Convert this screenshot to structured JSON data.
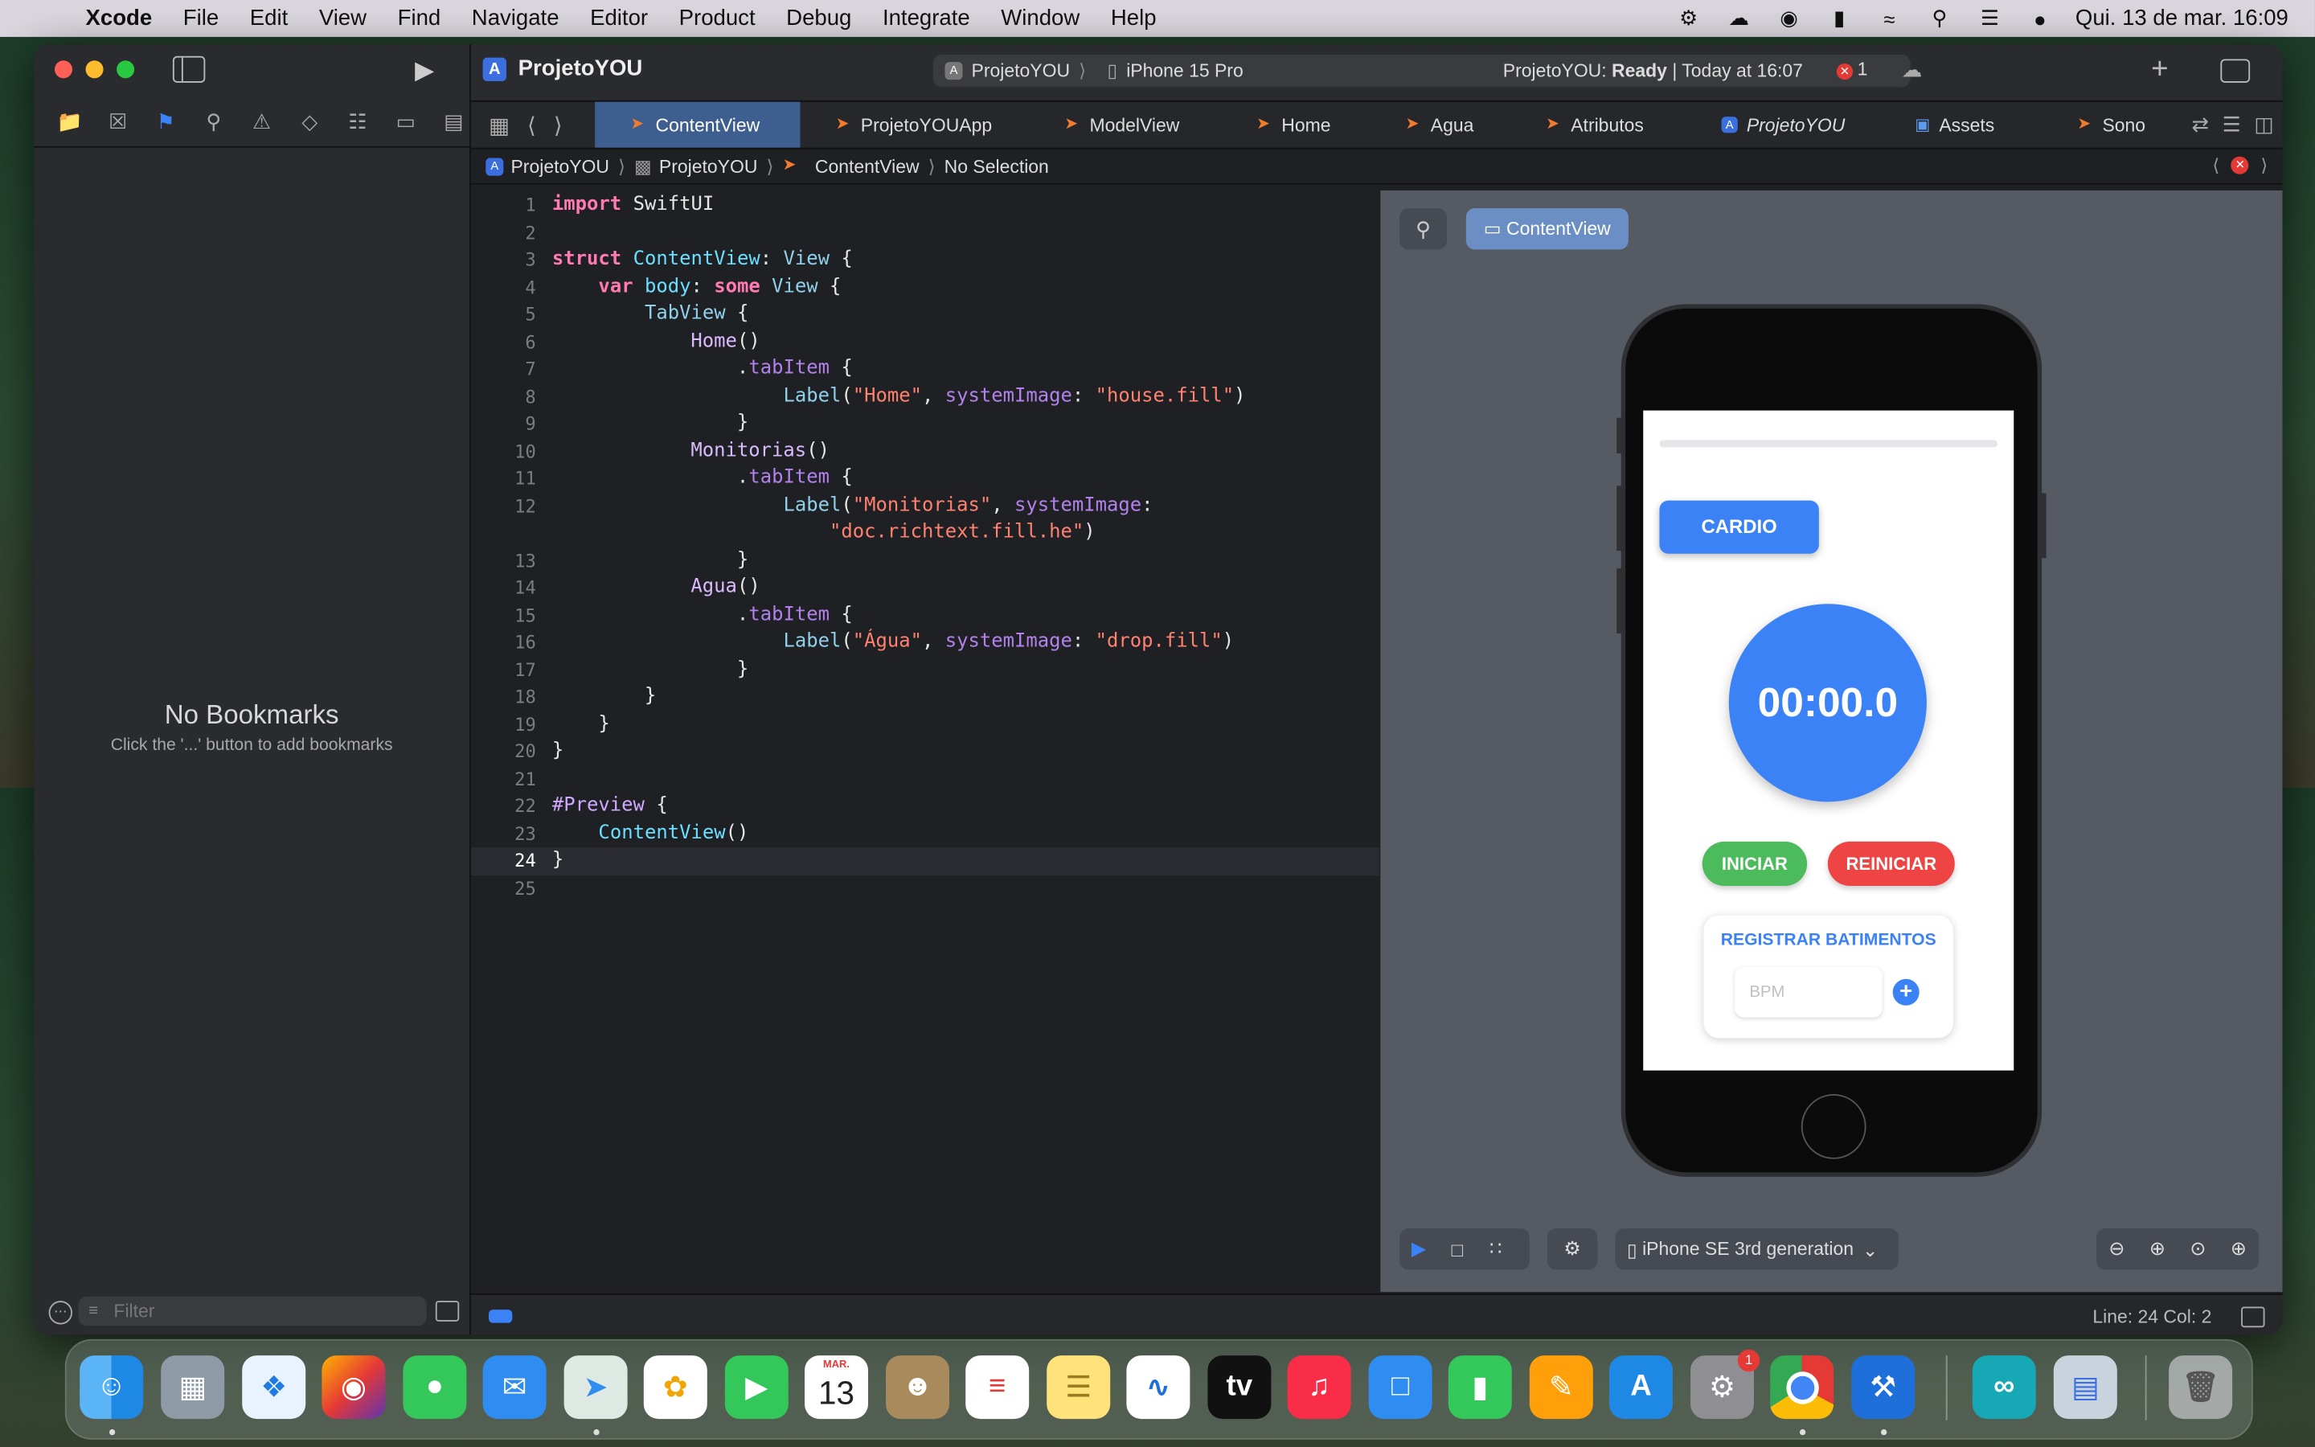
{
  "menubar": {
    "app": "Xcode",
    "items": [
      "File",
      "Edit",
      "View",
      "Find",
      "Navigate",
      "Editor",
      "Product",
      "Debug",
      "Integrate",
      "Window",
      "Help"
    ],
    "datetime": "Qui. 13 de mar.  16:09"
  },
  "toolbar": {
    "project": "ProjetoYOU",
    "scheme": "ProjetoYOU",
    "destination": "iPhone 15 Pro",
    "status_project": "ProjetoYOU:",
    "status_state": "Ready",
    "status_time": "| Today at 16:07",
    "error_count": "1"
  },
  "tabs": [
    {
      "label": "ContentView",
      "icon": "swift-icon",
      "active": true
    },
    {
      "label": "ProjetoYOUApp",
      "icon": "swift-icon"
    },
    {
      "label": "ModelView",
      "icon": "swift-icon"
    },
    {
      "label": "Home",
      "icon": "swift-icon"
    },
    {
      "label": "Agua",
      "icon": "swift-icon"
    },
    {
      "label": "Atributos",
      "icon": "swift-icon"
    },
    {
      "label": "ProjetoYOU",
      "icon": "xcode-project-icon"
    },
    {
      "label": "Assets",
      "icon": "assets-icon"
    },
    {
      "label": "Sono",
      "icon": "swift-icon"
    }
  ],
  "breadcrumb": [
    "ProjetoYOU",
    "ProjetoYOU",
    "ContentView",
    "No Selection"
  ],
  "sidebar": {
    "empty_title": "No Bookmarks",
    "empty_subtitle": "Click the '...' button to add bookmarks",
    "filter_placeholder": "Filter"
  },
  "editor": {
    "current_line": 24,
    "line_numbers": [
      "1",
      "2",
      "3",
      "4",
      "5",
      "6",
      "7",
      "8",
      "9",
      "10",
      "11",
      "12",
      "",
      "13",
      "14",
      "15",
      "16",
      "17",
      "18",
      "19",
      "20",
      "21",
      "22",
      "23",
      "24",
      "25"
    ]
  },
  "preview": {
    "canvas_button": "ContentView",
    "device": "iPhone SE 3rd generation",
    "progress": 0,
    "app": {
      "cardio_label": "CARDIO",
      "timer": "00:00.0",
      "start_label": "INICIAR",
      "reset_label": "REINICIAR",
      "bpm_title": "REGISTRAR BATIMENTOS",
      "bpm_placeholder": "BPM"
    }
  },
  "statusbar": {
    "position": "Line: 24  Col: 2"
  },
  "dock": {
    "calendar_month": "MAR.",
    "calendar_day": "13",
    "settings_badge": "1"
  },
  "colors": {
    "accent": "#3b82f6",
    "start_green": "#4cbb5c",
    "reset_red": "#ef4444",
    "active_tab": "#3d5e8f"
  }
}
